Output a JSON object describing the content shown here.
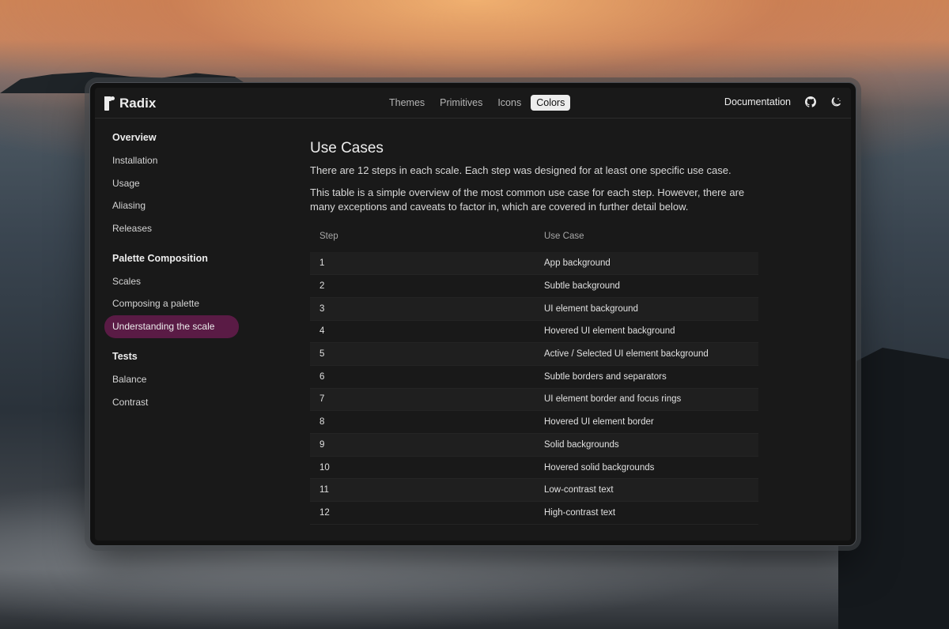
{
  "app": {
    "brand": "Radix"
  },
  "nav": {
    "items": [
      {
        "label": "Themes",
        "active": false
      },
      {
        "label": "Primitives",
        "active": false
      },
      {
        "label": "Icons",
        "active": false
      },
      {
        "label": "Colors",
        "active": true
      }
    ],
    "documentation_label": "Documentation",
    "github_icon": "github-icon",
    "theme_toggle_icon": "moon-icon"
  },
  "sidebar": {
    "sections": [
      {
        "title": "Overview",
        "items": [
          {
            "label": "Installation"
          },
          {
            "label": "Usage"
          },
          {
            "label": "Aliasing"
          },
          {
            "label": "Releases"
          }
        ]
      },
      {
        "title": "Palette Composition",
        "items": [
          {
            "label": "Scales"
          },
          {
            "label": "Composing a palette"
          },
          {
            "label": "Understanding the scale",
            "active": true
          }
        ]
      },
      {
        "title": "Tests",
        "items": [
          {
            "label": "Balance"
          },
          {
            "label": "Contrast"
          }
        ]
      }
    ]
  },
  "main": {
    "title": "Use Cases",
    "intro": "There are 12 steps in each scale. Each step was designed for at least one specific use case.",
    "description": "This table is a simple overview of the most common use case for each step. However, there are many exceptions and caveats to factor in, which are covered in further detail below.",
    "table": {
      "headers": [
        "Step",
        "Use Case"
      ],
      "rows": [
        [
          "1",
          "App background"
        ],
        [
          "2",
          "Subtle background"
        ],
        [
          "3",
          "UI element background"
        ],
        [
          "4",
          "Hovered UI element background"
        ],
        [
          "5",
          "Active / Selected UI element background"
        ],
        [
          "6",
          "Subtle borders and separators"
        ],
        [
          "7",
          "UI element border and focus rings"
        ],
        [
          "8",
          "Hovered UI element border"
        ],
        [
          "9",
          "Solid backgrounds"
        ],
        [
          "10",
          "Hovered solid backgrounds"
        ],
        [
          "11",
          "Low-contrast text"
        ],
        [
          "12",
          "High-contrast text"
        ]
      ]
    }
  },
  "colors": {
    "accent_active_sidebar": "#5a1b45",
    "window_bg": "#191919"
  }
}
